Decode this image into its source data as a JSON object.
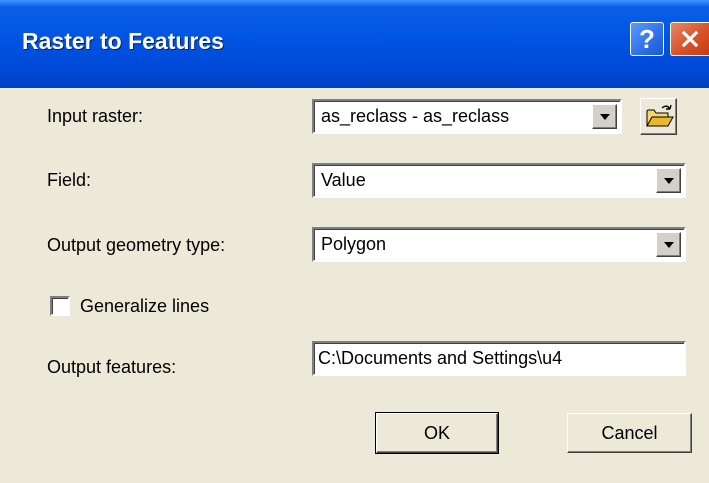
{
  "dialog": {
    "title": "Raster to Features",
    "help_glyph": "?",
    "close_glyph": "X"
  },
  "fields": {
    "input_raster": {
      "label": "Input raster:",
      "value": "as_reclass - as_reclass",
      "browse_icon": "open-folder-icon"
    },
    "field": {
      "label": "Field:",
      "value": "Value"
    },
    "geometry_type": {
      "label": "Output geometry type:",
      "value": "Polygon"
    },
    "generalize": {
      "label": "Generalize lines",
      "checked": false
    },
    "output_features": {
      "label": "Output features:",
      "value": "C:\\Documents and Settings\\u4"
    }
  },
  "buttons": {
    "ok": "OK",
    "cancel": "Cancel"
  },
  "colors": {
    "titlebar": "#0054e3",
    "face": "#ece9d8",
    "close": "#d8522a"
  }
}
